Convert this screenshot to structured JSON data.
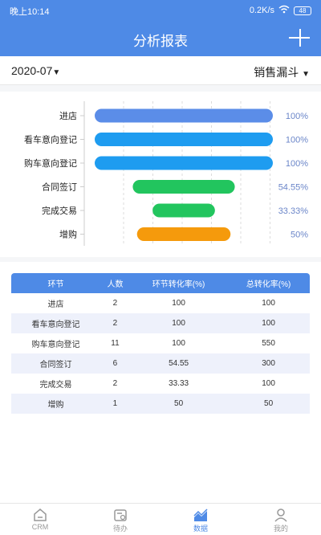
{
  "status": {
    "time": "晚上10:14",
    "speed": "0.2K/s",
    "battery": "48"
  },
  "appbar": {
    "title": "分析报表",
    "menu_icon": "plus-icon"
  },
  "filters": {
    "month": "2020-07",
    "funnel": "销售漏斗"
  },
  "colors": {
    "primary": "#4e8ae6",
    "blue": "#1e9cf0",
    "green": "#22c55e",
    "orange": "#f59a0c",
    "label": "#6b86c9"
  },
  "chart_data": {
    "type": "bar",
    "categories": [
      "进店",
      "看车意向登记",
      "购车意向登记",
      "合同签订",
      "完成交易",
      "增购"
    ],
    "values": [
      100,
      100,
      100,
      54.55,
      33.33,
      50
    ],
    "labels": [
      "100%",
      "100%",
      "100%",
      "54.55%",
      "33.33%",
      "50%"
    ],
    "colors": [
      "#5b8de8",
      "#1e9cf0",
      "#1e9cf0",
      "#22c55e",
      "#22c55e",
      "#f59a0c"
    ],
    "xlim": [
      0,
      100
    ],
    "orientation": "horizontal-funnel",
    "grid": true
  },
  "table": {
    "headers": [
      "环节",
      "人数",
      "环节转化率(%)",
      "总转化率(%)"
    ],
    "rows": [
      [
        "进店",
        "2",
        "100",
        "100"
      ],
      [
        "看车意向登记",
        "2",
        "100",
        "100"
      ],
      [
        "购车意向登记",
        "11",
        "100",
        "550"
      ],
      [
        "合同签订",
        "6",
        "54.55",
        "300"
      ],
      [
        "完成交易",
        "2",
        "33.33",
        "100"
      ],
      [
        "增购",
        "1",
        "50",
        "50"
      ]
    ]
  },
  "tabs": [
    {
      "label": "CRM",
      "icon": "home-icon",
      "active": false
    },
    {
      "label": "待办",
      "icon": "calendar-icon",
      "active": false
    },
    {
      "label": "数据",
      "icon": "chart-icon",
      "active": true
    },
    {
      "label": "我的",
      "icon": "user-icon",
      "active": false
    }
  ]
}
